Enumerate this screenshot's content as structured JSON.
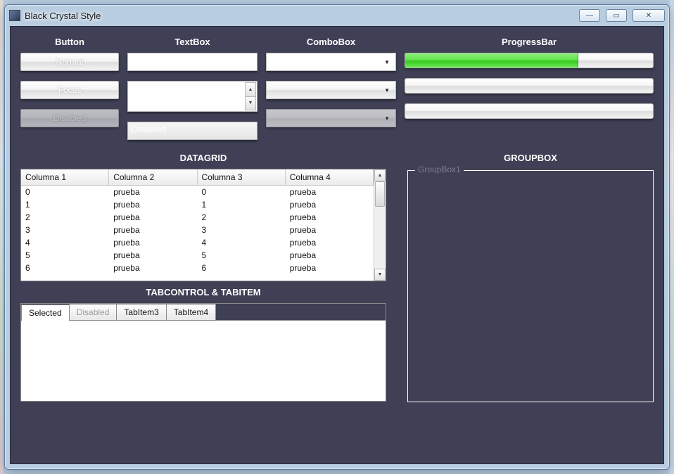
{
  "window": {
    "title": "Black Crystal Style"
  },
  "headers": {
    "button": "Button",
    "textbox": "TextBox",
    "combobox": "ComboBox",
    "progressbar": "ProgressBar"
  },
  "buttons": {
    "normal": "Normal",
    "focus": "Focus",
    "disabled": "Disabled"
  },
  "textboxes": {
    "normal": "",
    "multiline": "",
    "disabled_placeholder": "Disabled"
  },
  "progress": {
    "value_pct": 70
  },
  "sections": {
    "datagrid": "DATAGRID",
    "tabcontrol": "TABCONTROL & TABITEM",
    "groupbox": "GROUPBOX"
  },
  "datagrid": {
    "columns": [
      "Columna 1",
      "Columna 2",
      "Columna 3",
      "Columna 4"
    ],
    "rows": [
      [
        "0",
        "prueba",
        "0",
        "prueba"
      ],
      [
        "1",
        "prueba",
        "1",
        "prueba"
      ],
      [
        "2",
        "prueba",
        "2",
        "prueba"
      ],
      [
        "3",
        "prueba",
        "3",
        "prueba"
      ],
      [
        "4",
        "prueba",
        "4",
        "prueba"
      ],
      [
        "5",
        "prueba",
        "5",
        "prueba"
      ],
      [
        "6",
        "prueba",
        "6",
        "prueba"
      ]
    ]
  },
  "tabs": {
    "items": [
      {
        "label": "Selected",
        "state": "selected"
      },
      {
        "label": "Disabled",
        "state": "disabled"
      },
      {
        "label": "TabItem3",
        "state": "normal"
      },
      {
        "label": "TabItem4",
        "state": "normal"
      }
    ]
  },
  "groupbox": {
    "legend": "GroupBox1"
  }
}
